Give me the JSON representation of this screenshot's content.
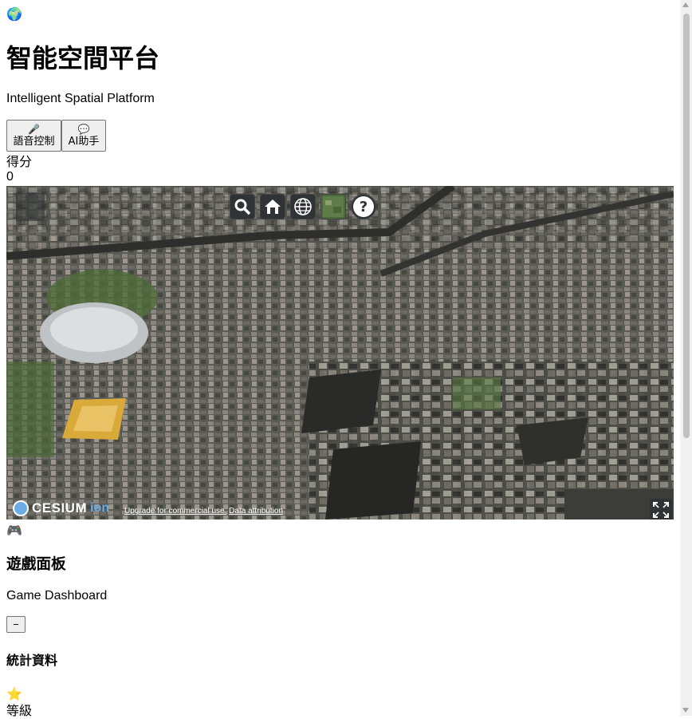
{
  "header": {
    "icon": "globe-emoji",
    "title": "智能空間平台",
    "subtitle": "Intelligent Spatial Platform"
  },
  "controls": {
    "voice_icon": "microphone-icon",
    "voice_label": "語音控制",
    "ai_icon": "speech-bubble-icon",
    "ai_label": "AI助手"
  },
  "score": {
    "label": "得分",
    "value": "0"
  },
  "viewer": {
    "logo_text": "CESIUM",
    "logo_suffix": "ion",
    "attribution_upgrade": "Upgrade for commercial use.",
    "attribution_data": "Data attribution",
    "toolbar": [
      "search-icon",
      "home-icon",
      "globe-icon",
      "layer-picker-icon",
      "help-icon"
    ],
    "colors": {
      "toolbar_bg": "#303336",
      "accent": "#6dabe4"
    }
  },
  "dashboard": {
    "icon": "game-controller-emoji",
    "title": "遊戲面板",
    "subtitle": "Game Dashboard",
    "collapse_label": "−",
    "stats_title": "統計資料",
    "level_icon": "star-emoji",
    "level_label": "等級"
  }
}
